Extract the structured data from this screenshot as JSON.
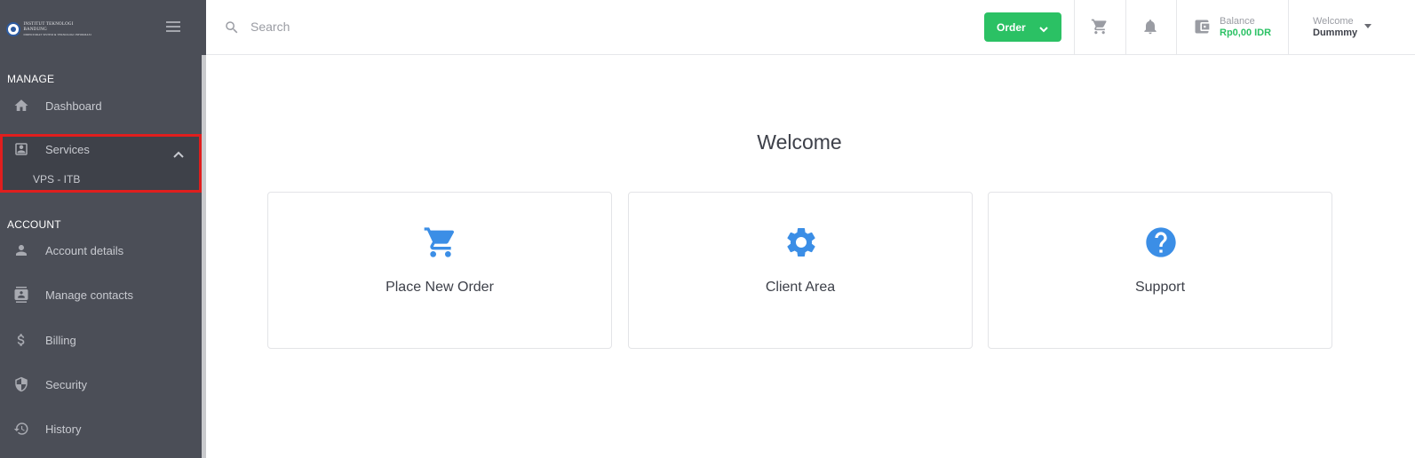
{
  "sidebar": {
    "logo_text_line1": "INSTITUT TEKNOLOGI BANDUNG",
    "logo_text_line2": "DIREKTORAT SISTEM & TEKNOLOGI INFORMASI",
    "sections": {
      "manage": "MANAGE",
      "account": "ACCOUNT"
    },
    "items": {
      "dashboard": "Dashboard",
      "services": "Services",
      "services_sub": "VPS - ITB",
      "account_details": "Account details",
      "manage_contacts": "Manage contacts",
      "billing": "Billing",
      "security": "Security",
      "history": "History"
    }
  },
  "header": {
    "search_placeholder": "Search",
    "order_label": "Order",
    "balance_label": "Balance",
    "balance_value": "Rp0,00 IDR",
    "welcome_label": "Welcome",
    "user_name": "Dummmy"
  },
  "main": {
    "title": "Welcome",
    "cards": [
      {
        "label": "Place New Order",
        "icon": "cart-icon"
      },
      {
        "label": "Client Area",
        "icon": "gear-icon"
      },
      {
        "label": "Support",
        "icon": "help-icon"
      }
    ]
  },
  "colors": {
    "sidebar_bg": "#4b4e57",
    "accent_green": "#2bc164",
    "icon_blue": "#3b8ee6",
    "highlight_red": "#e01e1e"
  }
}
